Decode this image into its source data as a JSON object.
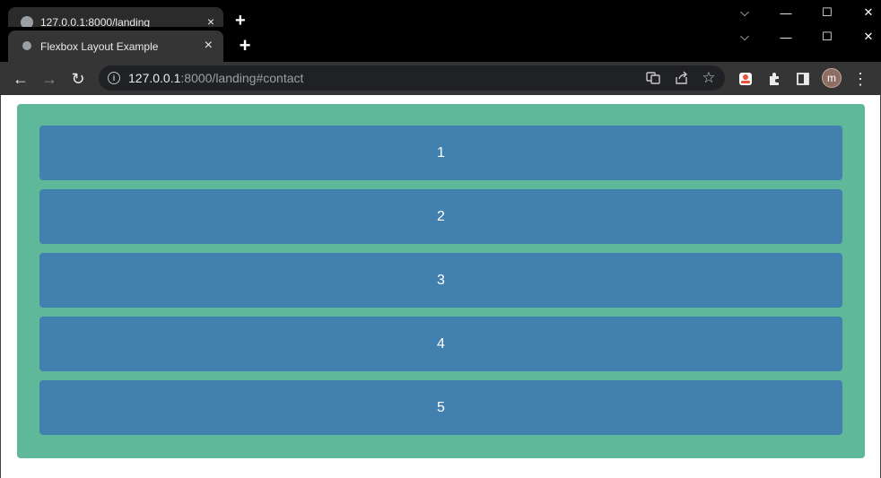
{
  "ghost_window": {
    "tab_title": "127.0.0.1:8000/landing",
    "close_glyph": "×",
    "newtab_glyph": "+"
  },
  "window": {
    "tab_title": "Flexbox Layout Example",
    "tab_close_glyph": "×",
    "newtab_glyph": "+",
    "controls": {
      "dropdown": "⌵",
      "minimize": "—",
      "maximize": "☐",
      "close": "✕"
    }
  },
  "toolbar": {
    "back": "←",
    "forward": "→",
    "reload": "↻",
    "url_host": "127.0.0.1",
    "url_rest": ":8000/landing#contact",
    "translate_icon": "translate-icon",
    "share_icon": "share-icon",
    "bookmark_glyph": "☆",
    "menu_glyph": "⋮",
    "avatar_letter": "m"
  },
  "page": {
    "container_color": "#5fb89a",
    "box_color": "#4281af",
    "items": [
      "1",
      "2",
      "3",
      "4",
      "5"
    ]
  }
}
